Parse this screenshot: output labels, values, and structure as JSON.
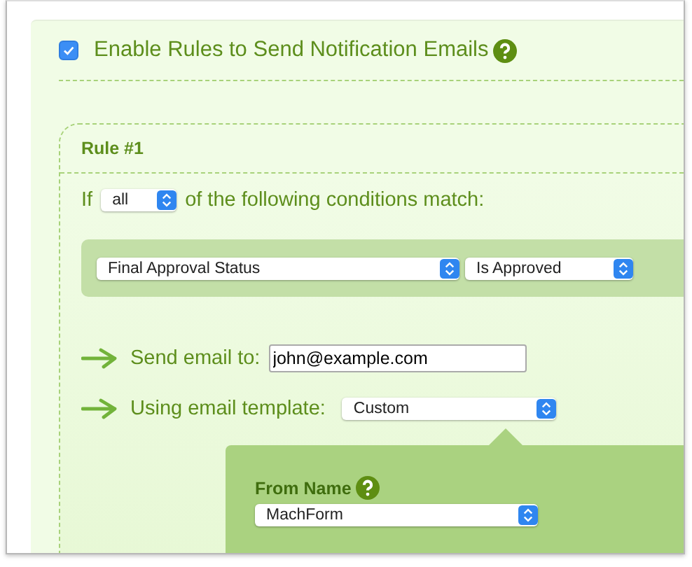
{
  "enable": {
    "checked": true,
    "label": "Enable Rules to Send Notification Emails"
  },
  "rule": {
    "title": "Rule #1",
    "match_prefix": "If",
    "match_select": "all",
    "match_suffix": "of the following conditions match:",
    "conditions": [
      {
        "field": "Final Approval Status",
        "operator": "Is Approved"
      }
    ],
    "send_to": {
      "label": "Send email to:",
      "value": "john@example.com"
    },
    "template": {
      "label": "Using email template:",
      "value": "Custom"
    },
    "from_name": {
      "label": "From Name",
      "value": "MachForm"
    }
  }
}
